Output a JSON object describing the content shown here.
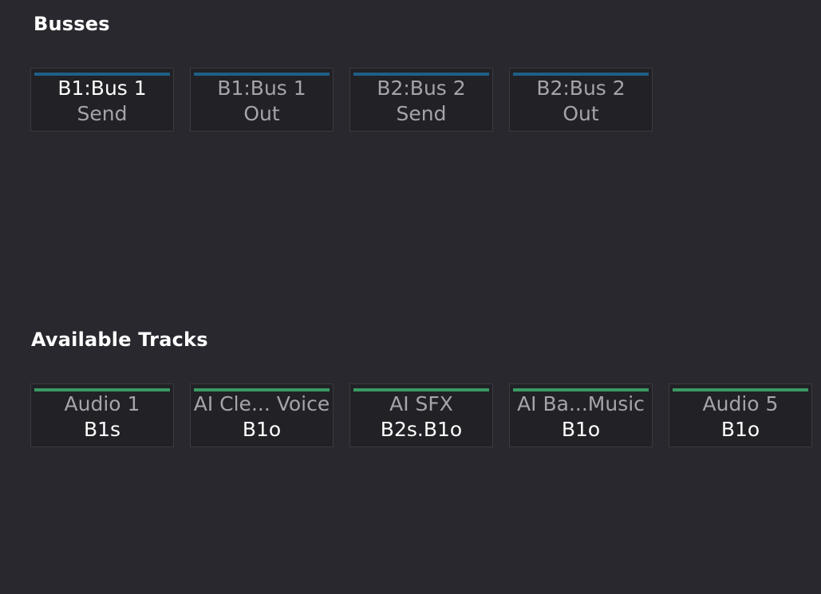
{
  "colors": {
    "background": "#28282e",
    "bus_bar": "#1f5f86",
    "track_bar": "#3b9a63"
  },
  "busses": {
    "title": "Busses",
    "items": [
      {
        "line1": "B1:Bus 1",
        "line2": "Send"
      },
      {
        "line1": "B1:Bus 1",
        "line2": "Out"
      },
      {
        "line1": "B2:Bus 2",
        "line2": "Send"
      },
      {
        "line1": "B2:Bus 2",
        "line2": "Out"
      }
    ]
  },
  "tracks": {
    "title": "Available Tracks",
    "items": [
      {
        "name": "Audio 1",
        "routing": "B1s"
      },
      {
        "name": "AI Cle... Voice",
        "routing": "B1o"
      },
      {
        "name": "AI SFX",
        "routing": "B2s.B1o"
      },
      {
        "name": "AI Ba...Music",
        "routing": "B1o"
      },
      {
        "name": "Audio 5",
        "routing": "B1o"
      }
    ]
  }
}
